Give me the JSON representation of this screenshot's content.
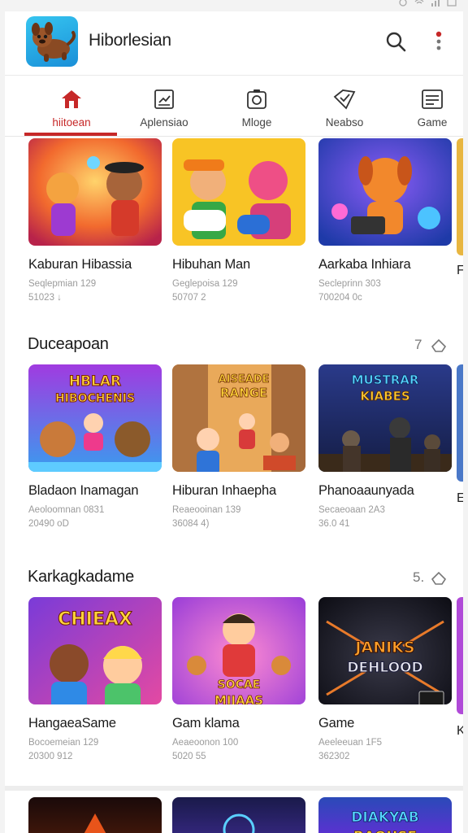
{
  "app": {
    "title": "Hiborlesian",
    "logo_icon": "dog-mascot-icon"
  },
  "tabs": [
    {
      "label": "hiitoean",
      "icon": "home-icon",
      "active": true
    },
    {
      "label": "Aplensiao",
      "icon": "trend-icon",
      "active": false
    },
    {
      "label": "Mloge",
      "icon": "camera-icon",
      "active": false
    },
    {
      "label": "Neabso",
      "icon": "tag-icon",
      "active": false
    },
    {
      "label": "Game",
      "icon": "list-icon",
      "active": false
    }
  ],
  "row1": [
    {
      "name": "Kaburan Hibassia",
      "sub": "Seqlepmian 129",
      "meta": "51023 ↓"
    },
    {
      "name": "Hibuhan Man",
      "sub": "Geglepoisa 129",
      "meta": "50707 2"
    },
    {
      "name": "Aarkaba Inhiara",
      "sub": "Secleprinn 303",
      "meta": "700204 0c"
    }
  ],
  "row1_edge_char": "F",
  "section2": {
    "title": "Duceapoan",
    "count": "7",
    "tiles": [
      {
        "name": "Bladaon Inamagan",
        "sub": "Aeoloomnan 0831",
        "meta": "20490 oD",
        "banner": "HBLAR HIBOCHENIS"
      },
      {
        "name": "Hiburan Inhaepha",
        "sub": "Reaeooinan 139",
        "meta": "36084 4)",
        "banner": "AISEADE RANGE"
      },
      {
        "name": "Phanoaaunyada",
        "sub": "Secaeoaan 2A3",
        "meta": "36.0 41",
        "banner": "MUSTRAR KIABES"
      }
    ],
    "edge_char": "E"
  },
  "section3": {
    "title": "Karkagkadame",
    "count": "5.",
    "tiles": [
      {
        "name": "HangaeaSame",
        "sub": "Bocoemeian 129",
        "meta": "20300 912",
        "banner": "CHIEAX"
      },
      {
        "name": "Gam klama",
        "sub": "Aeaeoonon 100",
        "meta": "5020 55",
        "banner": "SOCAE MIJAAS"
      },
      {
        "name": "Game",
        "sub": "Aeeleeuan 1F5",
        "meta": "362302",
        "banner": "JANIKS DEHLOOD"
      }
    ],
    "edge_char": "K"
  },
  "bottom_row": [
    {
      "banner": ""
    },
    {
      "banner": ""
    },
    {
      "banner": "DIAKYAB RAOUSE"
    }
  ],
  "colors": {
    "accent": "#c62828",
    "text": "#1a1a1a",
    "muted": "#9b9b9b"
  }
}
